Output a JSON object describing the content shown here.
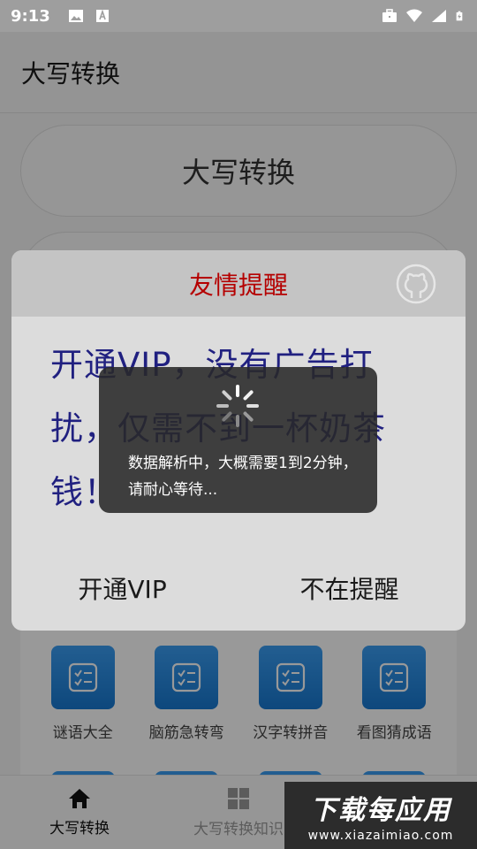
{
  "status_bar": {
    "time": "9:13"
  },
  "app_bar": {
    "title": "大写转换"
  },
  "main": {
    "primary_button": "大写转换",
    "secondary_button": ""
  },
  "grid": {
    "items": [
      {
        "label": "谜语大全",
        "icon": "checklist-icon"
      },
      {
        "label": "脑筋急转弯",
        "icon": "checklist-icon"
      },
      {
        "label": "汉字转拼音",
        "icon": "checklist-icon"
      },
      {
        "label": "看图猜成语",
        "icon": "checklist-icon"
      }
    ]
  },
  "bottom_nav": {
    "items": [
      {
        "label": "大写转换",
        "icon": "home-icon",
        "active": true
      },
      {
        "label": "大写转换知识",
        "icon": "grid-icon",
        "active": false
      },
      {
        "label": "",
        "icon": "",
        "active": false
      }
    ]
  },
  "dialog": {
    "title": "友情提醒",
    "message": "开通VIP，没有广告打扰，仅需不到一杯奶茶钱！",
    "confirm_label": "开通VIP",
    "dismiss_label": "不在提醒"
  },
  "loading": {
    "message": "数据解析中，大概需要1到2分钟，请耐心等待..."
  },
  "watermark": {
    "title": "下载每应用",
    "url": "www.xiazaimiao.com"
  },
  "colors": {
    "status_bar": "#9e9e9e",
    "dialog_title": "#b50000",
    "dialog_message": "#202080",
    "grid_icon": "#1e88e5"
  }
}
